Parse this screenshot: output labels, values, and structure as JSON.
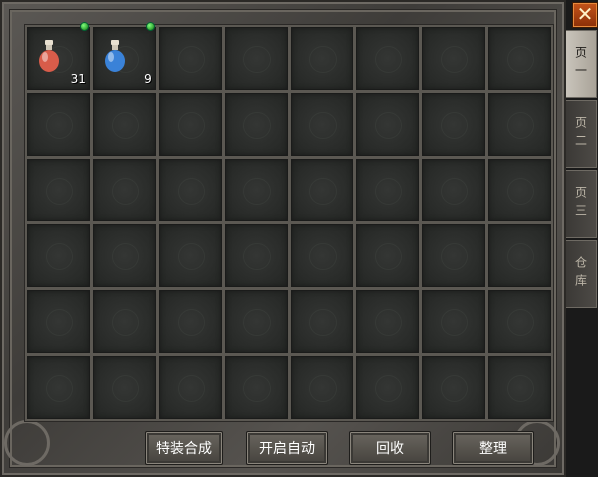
{
  "tabs": [
    {
      "label": "页一",
      "active": true
    },
    {
      "label": "页二",
      "active": false
    },
    {
      "label": "页三",
      "active": false
    },
    {
      "label": "仓库",
      "active": false
    }
  ],
  "close_icon": "close-icon",
  "close_symbol": "✕",
  "items": [
    {
      "slot": 0,
      "name": "red-potion-icon",
      "quantity": "31",
      "color": "#d85c4a",
      "indicator": true
    },
    {
      "slot": 1,
      "name": "blue-potion-icon",
      "quantity": "9",
      "color": "#3a82d8",
      "indicator": true
    }
  ],
  "buttons": {
    "synthesize": "特装合成",
    "auto": "开启自动",
    "recycle": "回收",
    "sort": "整理"
  },
  "grid": {
    "columns": 8,
    "rows": 6
  }
}
